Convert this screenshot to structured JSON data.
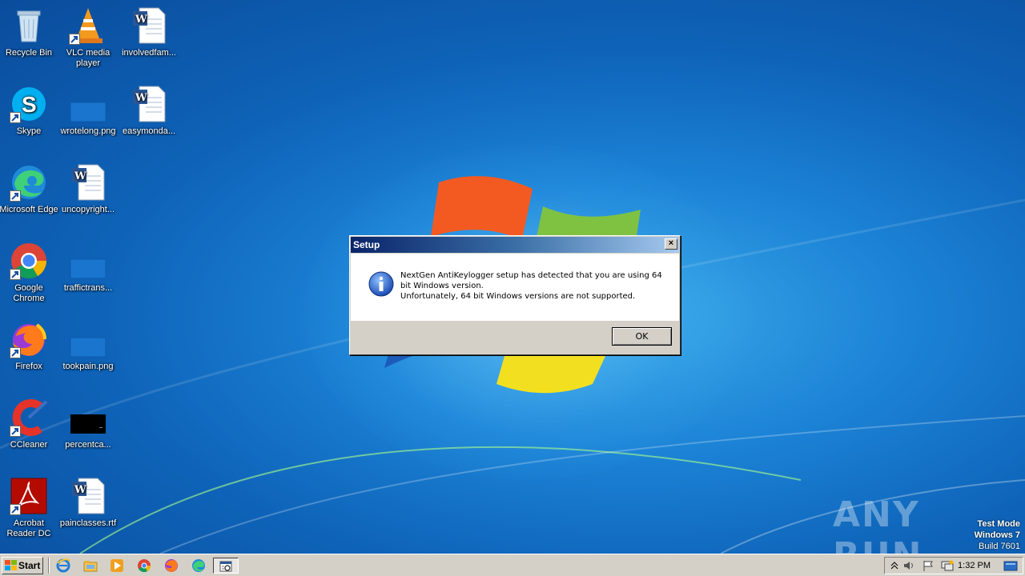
{
  "desktop": {
    "icons": [
      {
        "label": "Recycle Bin",
        "icon": "recycle-bin-icon",
        "shortcut": false
      },
      {
        "label": "VLC media player",
        "icon": "vlc-icon",
        "shortcut": true
      },
      {
        "label": "involvedfam...",
        "icon": "word-doc-icon",
        "shortcut": false
      },
      {
        "label": "Skype",
        "icon": "skype-icon",
        "shortcut": true
      },
      {
        "label": "wrotelong.png",
        "icon": "png-file-icon",
        "shortcut": false
      },
      {
        "label": "easymonda...",
        "icon": "word-doc-icon",
        "shortcut": false
      },
      {
        "label": "Microsoft Edge",
        "icon": "edge-icon",
        "shortcut": true
      },
      {
        "label": "uncopyright...",
        "icon": "word-doc-icon",
        "shortcut": false
      },
      {
        "label": "Google Chrome",
        "icon": "chrome-icon",
        "shortcut": true
      },
      {
        "label": "traffictrans...",
        "icon": "png-file-icon",
        "shortcut": false
      },
      {
        "label": "Firefox",
        "icon": "firefox-icon",
        "shortcut": true
      },
      {
        "label": "tookpain.png",
        "icon": "png-file-icon",
        "shortcut": false
      },
      {
        "label": "CCleaner",
        "icon": "ccleaner-icon",
        "shortcut": true
      },
      {
        "label": "percentca...",
        "icon": "black-image-icon",
        "shortcut": false
      },
      {
        "label": "Acrobat Reader DC",
        "icon": "acrobat-icon",
        "shortcut": true
      },
      {
        "label": "painclasses.rtf",
        "icon": "word-doc-icon",
        "shortcut": false
      }
    ]
  },
  "dialog": {
    "title": "Setup",
    "close_label": "×",
    "message_line1": "NextGen AntiKeylogger setup has detected that you are using 64 bit Windows version.",
    "message_line2": "Unfortunately, 64 bit Windows versions are not supported.",
    "ok_label": "OK",
    "icon": "info-icon"
  },
  "taskbar": {
    "start_label": "Start",
    "quick_launch": [
      "ie-icon",
      "explorer-icon",
      "media-player-icon",
      "chrome-icon",
      "firefox-icon",
      "edge-icon"
    ],
    "active_app_icon": "setup-icon",
    "clock": "1:32 PM"
  },
  "watermark": {
    "text": "ANY RUN"
  },
  "mode_info": {
    "line1": "Test Mode",
    "line2": "Windows 7",
    "line3": "Build 7601"
  },
  "colors": {
    "desktop_blue": "#1c83d6",
    "titlebar_start": "#0a246a",
    "titlebar_end": "#a6caf0",
    "taskbar": "#d4d0c8"
  }
}
